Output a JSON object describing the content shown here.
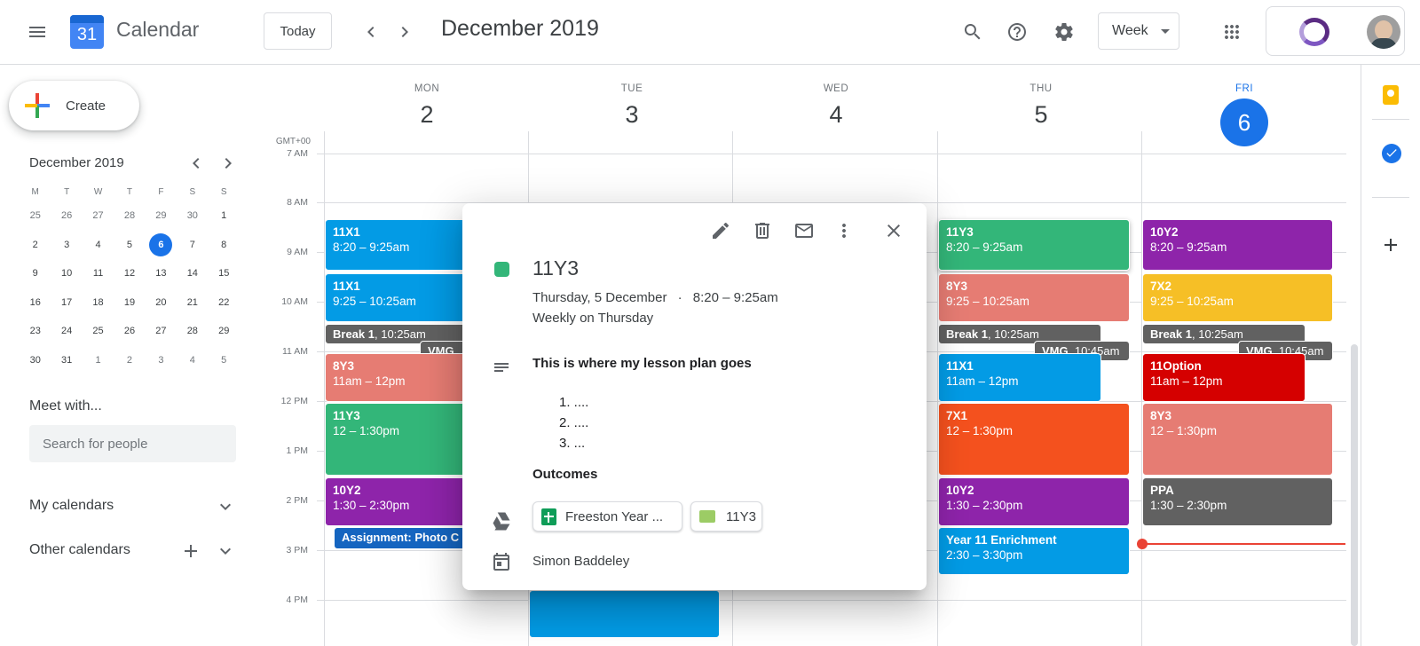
{
  "header": {
    "app_title": "Calendar",
    "logo_number": "31",
    "today_label": "Today",
    "period_title": "December 2019",
    "view_label": "Week"
  },
  "sidebar": {
    "create_label": "Create",
    "mini_month_title": "December 2019",
    "weekday_heads": [
      "M",
      "T",
      "W",
      "T",
      "F",
      "S",
      "S"
    ],
    "mini_weeks": [
      [
        "25",
        "26",
        "27",
        "28",
        "29",
        "30",
        "1"
      ],
      [
        "2",
        "3",
        "4",
        "5",
        "6",
        "7",
        "8"
      ],
      [
        "9",
        "10",
        "11",
        "12",
        "13",
        "14",
        "15"
      ],
      [
        "16",
        "17",
        "18",
        "19",
        "20",
        "21",
        "22"
      ],
      [
        "23",
        "24",
        "25",
        "26",
        "27",
        "28",
        "29"
      ],
      [
        "30",
        "31",
        "1",
        "2",
        "3",
        "4",
        "5"
      ]
    ],
    "meet_title": "Meet with...",
    "people_placeholder": "Search for people",
    "my_calendars": "My calendars",
    "other_calendars": "Other calendars"
  },
  "grid": {
    "timezone": "GMT+00",
    "days": [
      {
        "name": "MON",
        "num": "2"
      },
      {
        "name": "TUE",
        "num": "3"
      },
      {
        "name": "WED",
        "num": "4"
      },
      {
        "name": "THU",
        "num": "5"
      },
      {
        "name": "FRI",
        "num": "6"
      }
    ],
    "hours": [
      "7 AM",
      "8 AM",
      "9 AM",
      "10 AM",
      "11 AM",
      "12 PM",
      "1 PM",
      "2 PM",
      "3 PM",
      "4 PM"
    ]
  },
  "events": {
    "mon": [
      {
        "title": "11X1",
        "time": "8:20 – 9:25am"
      },
      {
        "title": "11X1",
        "time": "9:25 – 10:25am"
      },
      {
        "title": "Break 1",
        "time": ", 10:25am"
      },
      {
        "title": "VMG,",
        "time": ""
      },
      {
        "title": "8Y3",
        "time": "11am – 12pm"
      },
      {
        "title": "11Y3",
        "time": "12 – 1:30pm"
      },
      {
        "title": "10Y2",
        "time": "1:30 – 2:30pm"
      },
      {
        "title": "Assignment: Photo C",
        "time": ""
      }
    ],
    "thu": [
      {
        "title": "11Y3",
        "time": "8:20 – 9:25am"
      },
      {
        "title": "8Y3",
        "time": "9:25 – 10:25am"
      },
      {
        "title": "Break 1",
        "time": ", 10:25am"
      },
      {
        "title": "VMG",
        "time": ", 10:45am"
      },
      {
        "title": "11X1",
        "time": "11am – 12pm"
      },
      {
        "title": "7X1",
        "time": "12 – 1:30pm"
      },
      {
        "title": "10Y2",
        "time": "1:30 – 2:30pm"
      },
      {
        "title": "Year 11 Enrichment",
        "time": "2:30 – 3:30pm"
      }
    ],
    "fri": [
      {
        "title": "10Y2",
        "time": "8:20 – 9:25am"
      },
      {
        "title": "7X2",
        "time": "9:25 – 10:25am"
      },
      {
        "title": "Break 1",
        "time": ", 10:25am"
      },
      {
        "title": "VMG",
        "time": ", 10:45am"
      },
      {
        "title": "11Option",
        "time": "11am – 12pm"
      },
      {
        "title": "8Y3",
        "time": "12 – 1:30pm"
      },
      {
        "title": "PPA",
        "time": "1:30 – 2:30pm"
      }
    ]
  },
  "colors": {
    "blue": "#039be5",
    "green": "#33b679",
    "purple": "#8e24aa",
    "salmon": "#e67c73",
    "grey": "#616161",
    "yellow": "#f6bf26",
    "red": "#d50000",
    "orange": "#f4511e",
    "accent": "#1a73e8",
    "now_line": "#ea4335"
  },
  "popup": {
    "title": "11Y3",
    "date_line": "Thursday, 5 December",
    "time_line": "8:20 – 9:25am",
    "separator": "·",
    "recurrence": "Weekly on Thursday",
    "description_heading": "This is where my lesson plan goes",
    "list_items": [
      "1. ....",
      "2. ....",
      "3. ..."
    ],
    "outcomes_heading": "Outcomes",
    "attachments": [
      {
        "label": "Freeston Year ...",
        "icon": "sheets-icon"
      },
      {
        "label": "11Y3",
        "icon": "folder-icon"
      }
    ],
    "organizer": "Simon Baddeley"
  }
}
